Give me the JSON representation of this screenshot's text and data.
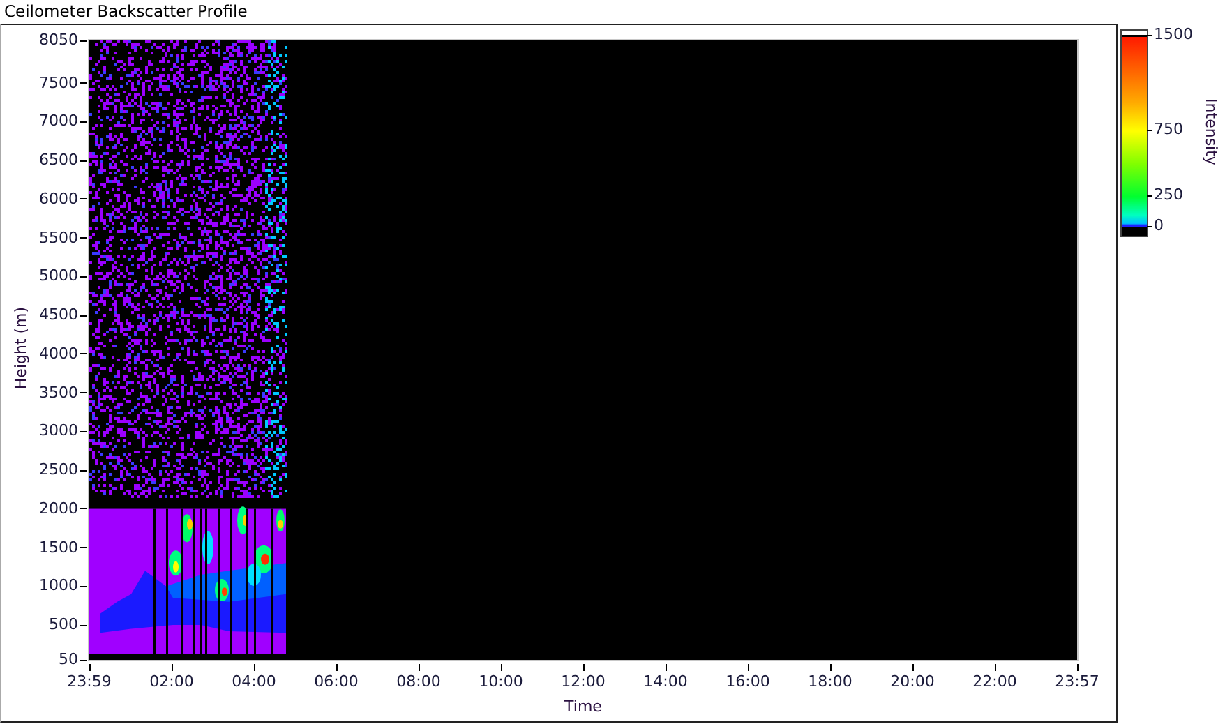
{
  "title": "Ceilometer Backscatter Profile",
  "graph": {
    "y_axis": {
      "label": "Height (m)",
      "ticks": [
        "8050",
        "7500",
        "7000",
        "6500",
        "6000",
        "5500",
        "5000",
        "4500",
        "4000",
        "3500",
        "3000",
        "2500",
        "2000",
        "1500",
        "1000",
        "500",
        "50"
      ]
    },
    "x_axis": {
      "label": "Time",
      "ticks": [
        "23:59",
        "02:00",
        "04:00",
        "06:00",
        "08:00",
        "10:00",
        "12:00",
        "14:00",
        "16:00",
        "18:00",
        "20:00",
        "22:00",
        "23:57"
      ]
    },
    "color_scale": {
      "label": "Intensity",
      "ticks": [
        "1500",
        "750",
        "250",
        "0"
      ]
    }
  }
}
